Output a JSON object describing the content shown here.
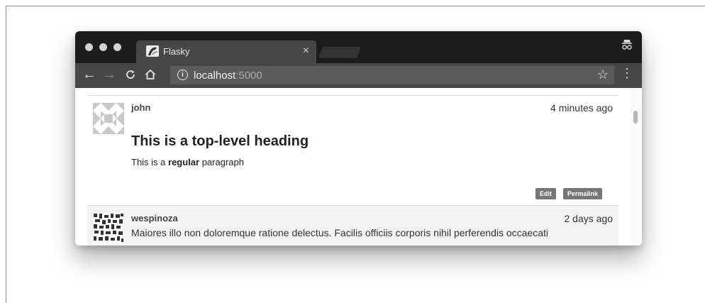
{
  "browser": {
    "tab_title": "Flasky",
    "tab_close": "×",
    "url_host": "localhost",
    "url_port": ":5000"
  },
  "posts": [
    {
      "author": "john",
      "date": "4 minutes ago",
      "heading": "This is a top-level heading",
      "body_before": "This is a ",
      "body_bold": "regular",
      "body_after": " paragraph",
      "buttons": {
        "edit": "Edit",
        "permalink": "Permalink"
      }
    },
    {
      "author": "wespinoza",
      "date": "2 days ago",
      "body": "Maiores illo non doloremque ratione delectus. Facilis officiis corporis nihil perferendis occaecati"
    }
  ],
  "icons": {
    "back": "arrow-left-icon",
    "forward": "arrow-right-icon",
    "reload": "reload-icon",
    "home": "home-icon",
    "info": "info-icon",
    "star": "star-icon",
    "menu": "kebab-menu-icon",
    "incognito": "incognito-icon"
  }
}
